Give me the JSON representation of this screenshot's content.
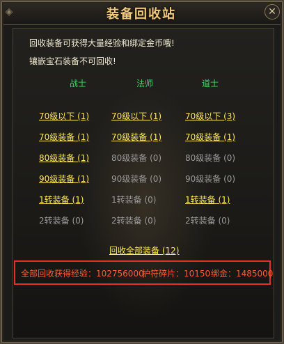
{
  "window": {
    "title": "装备回收站",
    "close_icon": "close-icon"
  },
  "intro": [
    "回收装备可获得大量经验和绑定金币哦!",
    "镶嵌宝石装备不可回收!"
  ],
  "columns": [
    {
      "header": "战士",
      "items": [
        {
          "label": "70级以下 (1)",
          "active": true
        },
        {
          "label": "70级装备 (1)",
          "active": true
        },
        {
          "label": "80级装备 (1)",
          "active": true
        },
        {
          "label": "90级装备 (1)",
          "active": true
        },
        {
          "label": "1转装备 (1)",
          "active": true
        },
        {
          "label": "2转装备 (0)",
          "active": false
        }
      ]
    },
    {
      "header": "法师",
      "items": [
        {
          "label": "70级以下 (1)",
          "active": true
        },
        {
          "label": "70级装备 (1)",
          "active": true
        },
        {
          "label": "80级装备 (0)",
          "active": false
        },
        {
          "label": "90级装备 (0)",
          "active": false
        },
        {
          "label": "1转装备 (0)",
          "active": false
        },
        {
          "label": "2转装备 (0)",
          "active": false
        }
      ]
    },
    {
      "header": "道士",
      "items": [
        {
          "label": "70级以下 (3)",
          "active": true
        },
        {
          "label": "70级装备 (1)",
          "active": true
        },
        {
          "label": "80级装备 (0)",
          "active": false
        },
        {
          "label": "90级装备 (0)",
          "active": false
        },
        {
          "label": "1转装备 (1)",
          "active": true
        },
        {
          "label": "2转装备 (0)",
          "active": false
        }
      ]
    }
  ],
  "recycle_all": "回收全部装备 (12)",
  "summary": {
    "exp": "全部回收获得经验：102756000",
    "fragments": "护符碎片：10150",
    "bound_gold": "绑金：1485000"
  },
  "colors": {
    "title": "#f2c978",
    "column_header": "#2fe062",
    "active_link": "#ffe94a",
    "inactive": "#9a9a9a",
    "summary_text": "#ff5a2a",
    "summary_border": "#e0322a"
  }
}
